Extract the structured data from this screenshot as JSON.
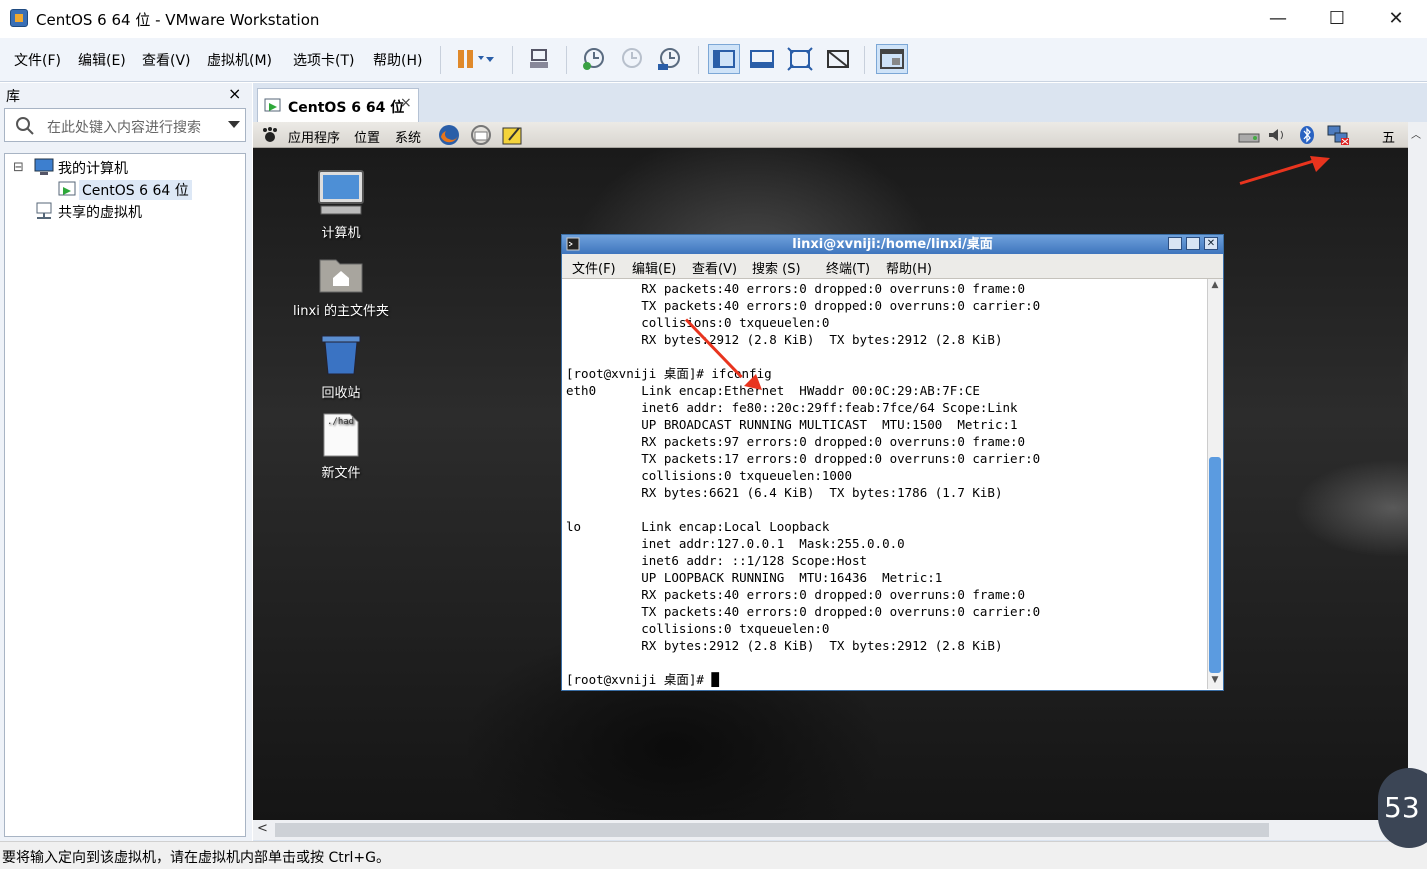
{
  "window": {
    "title": "CentOS 6 64 位 - VMware Workstation",
    "min": "—",
    "max": "☐",
    "close": "✕"
  },
  "menu": [
    "文件(F)",
    "编辑(E)",
    "查看(V)",
    "虚拟机(M)",
    "选项卡(T)",
    "帮助(H)"
  ],
  "library": {
    "title": "库",
    "close": "×",
    "search_placeholder": "在此处键入内容进行搜索",
    "tree": {
      "root": "我的计算机",
      "vm": "CentOS 6 64 位",
      "shared": "共享的虚拟机"
    },
    "expander": "⊟"
  },
  "tab": {
    "label": "CentOS 6 64 位",
    "close": "×"
  },
  "guest_panel": {
    "apps": "应用程序",
    "places": "位置",
    "system": "系统",
    "clock": "五"
  },
  "desktop_icons": [
    "计算机",
    "linxi 的主文件夹",
    "回收站",
    "新文件"
  ],
  "file_icon_text": "./had",
  "terminal": {
    "title": "linxi@xvniji:/home/linxi/桌面",
    "menu": [
      "文件(F)",
      "编辑(E)",
      "查看(V)",
      "搜索 (S)",
      "终端(T)",
      "帮助(H)"
    ],
    "lines": [
      "          RX packets:40 errors:0 dropped:0 overruns:0 frame:0",
      "          TX packets:40 errors:0 dropped:0 overruns:0 carrier:0",
      "          collisions:0 txqueuelen:0",
      "          RX bytes:2912 (2.8 KiB)  TX bytes:2912 (2.8 KiB)",
      "",
      "[root@xvniji 桌面]# ifconfig",
      "eth0      Link encap:Ethernet  HWaddr 00:0C:29:AB:7F:CE",
      "          inet6 addr: fe80::20c:29ff:feab:7fce/64 Scope:Link",
      "          UP BROADCAST RUNNING MULTICAST  MTU:1500  Metric:1",
      "          RX packets:97 errors:0 dropped:0 overruns:0 frame:0",
      "          TX packets:17 errors:0 dropped:0 overruns:0 carrier:0",
      "          collisions:0 txqueuelen:1000",
      "          RX bytes:6621 (6.4 KiB)  TX bytes:1786 (1.7 KiB)",
      "",
      "lo        Link encap:Local Loopback",
      "          inet addr:127.0.0.1  Mask:255.0.0.0",
      "          inet6 addr: ::1/128 Scope:Host",
      "          UP LOOPBACK RUNNING  MTU:16436  Metric:1",
      "          RX packets:40 errors:0 dropped:0 overruns:0 frame:0",
      "          TX packets:40 errors:0 dropped:0 overruns:0 carrier:0",
      "          collisions:0 txqueuelen:0",
      "          RX bytes:2912 (2.8 KiB)  TX bytes:2912 (2.8 KiB)",
      "",
      "[root@xvniji 桌面]# "
    ]
  },
  "status_text": "要将输入定向到该虚拟机，请在虚拟机内部单击或按 Ctrl+G。",
  "timer": "53",
  "colors": {
    "accent": "#3e75bd",
    "annotation_arrow": "#e8341e"
  }
}
